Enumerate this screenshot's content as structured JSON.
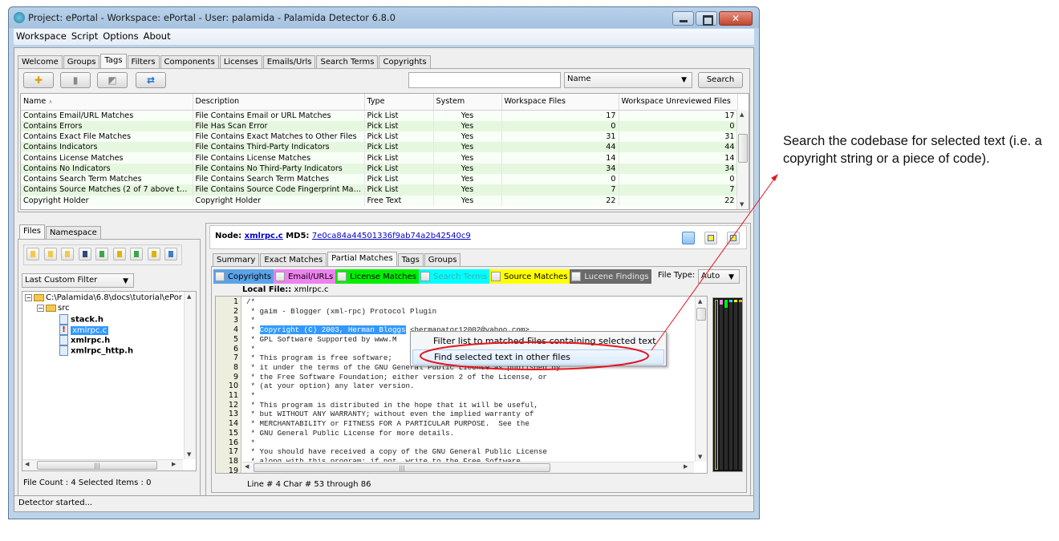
{
  "window": {
    "title": "Project: ePortal - Workspace: ePortal - User: palamida - Palamida Detector 6.8.0",
    "close_glyph": "✕"
  },
  "menu": [
    "Workspace",
    "Script",
    "Options",
    "About"
  ],
  "top_tabs": [
    {
      "label": "Welcome",
      "active": false
    },
    {
      "label": "Groups",
      "active": false
    },
    {
      "label": "Tags",
      "active": true
    },
    {
      "label": "Filters",
      "active": false
    },
    {
      "label": "Components",
      "active": false
    },
    {
      "label": "Licenses",
      "active": false
    },
    {
      "label": "Emails/Urls",
      "active": false
    },
    {
      "label": "Search Terms",
      "active": false
    },
    {
      "label": "Copyrights",
      "active": false
    }
  ],
  "toolbar": {
    "buttons": [
      {
        "icon": "add-tag-icon",
        "glyph": "✚"
      },
      {
        "icon": "delete-tag-icon",
        "glyph": "▮"
      },
      {
        "icon": "edit-tag-icon",
        "glyph": "◩"
      },
      {
        "icon": "refresh-icon",
        "glyph": "⇄"
      }
    ],
    "search_value": "",
    "search_field_selected": "Name",
    "search_label": "Search"
  },
  "tags_table": {
    "columns": [
      "Name",
      "Description",
      "Type",
      "System",
      "Workspace Files",
      "Workspace Unreviewed Files"
    ],
    "sort_indicator": "∧",
    "rows": [
      [
        "Contains Email/URL Matches",
        "File Contains Email or URL Matches",
        "Pick List",
        "Yes",
        "17",
        "17"
      ],
      [
        "Contains Errors",
        "File Has Scan Error",
        "Pick List",
        "Yes",
        "0",
        "0"
      ],
      [
        "Contains Exact File Matches",
        "File Contains Exact Matches to Other Files",
        "Pick List",
        "Yes",
        "31",
        "31"
      ],
      [
        "Contains Indicators",
        "File Contains Third-Party Indicators",
        "Pick List",
        "Yes",
        "44",
        "44"
      ],
      [
        "Contains License Matches",
        "File Contains License Matches",
        "Pick List",
        "Yes",
        "14",
        "14"
      ],
      [
        "Contains No Indicators",
        "File Contains No Third-Party Indicators",
        "Pick List",
        "Yes",
        "34",
        "34"
      ],
      [
        "Contains Search Term Matches",
        "File Contains Search Term Matches",
        "Pick List",
        "Yes",
        "0",
        "0"
      ],
      [
        "Contains Source Matches (2 of 7 above th...",
        "File Contains Source Code Fingerprint Mat...",
        "Pick List",
        "Yes",
        "7",
        "7"
      ],
      [
        "Copyright Holder",
        "Copyright Holder",
        "Free Text",
        "Yes",
        "22",
        "22"
      ]
    ]
  },
  "left_panel": {
    "tabs": [
      {
        "label": "Files",
        "active": true
      },
      {
        "label": "Namespace",
        "active": false
      }
    ],
    "tool_icons": [
      "expand-all-icon",
      "collapse-all-icon",
      "tree-view-icon",
      "flat-view-icon",
      "mark-reviewed-icon",
      "warning-file-icon",
      "approve-icon",
      "warning-icon",
      "find-file-icon"
    ],
    "filter_selected": "Last Custom Filter",
    "tree": {
      "root": "C:\\Palamida\\6.8\\docs\\tutorial\\ePor",
      "folder": "src",
      "files": [
        {
          "name": "stack.h",
          "selected": false,
          "flag": false
        },
        {
          "name": "xmlrpc.c",
          "selected": true,
          "flag": true
        },
        {
          "name": "xmlrpc.h",
          "selected": false,
          "flag": false
        },
        {
          "name": "xmlrpc_http.h",
          "selected": false,
          "flag": false
        }
      ]
    },
    "footer": "File Count : 4   Selected Items : 0"
  },
  "right_panel": {
    "node_label": "Node:",
    "node_value": "xmlrpc.c",
    "md5_label": "MD5:",
    "md5_value": "7e0ca84a44501336f9ab74a2b42540c9",
    "view_icons": [
      "layout-single-icon",
      "layout-split-icon",
      "layout-compare-icon"
    ],
    "tabs": [
      {
        "label": "Summary",
        "active": false
      },
      {
        "label": "Exact Matches",
        "active": false
      },
      {
        "label": "Partial Matches",
        "active": true
      },
      {
        "label": "Tags",
        "active": false
      },
      {
        "label": "Groups",
        "active": false
      }
    ],
    "legend": [
      {
        "label": "Copyrights",
        "color": "#5ba3e8",
        "text": "#000000"
      },
      {
        "label": "Email/URLs",
        "color": "#ee82ee",
        "text": "#000000"
      },
      {
        "label": "License Matches",
        "color": "#00ee00",
        "text": "#000000"
      },
      {
        "label": "Search Terms",
        "color": "#00ffff",
        "text": "#44aaaa"
      },
      {
        "label": "Source Matches",
        "color": "#ffff00",
        "text": "#000000"
      },
      {
        "label": "Lucene Findings",
        "color": "#6a6a6a",
        "text": "#e8e8e8"
      }
    ],
    "file_type_label": "File Type:",
    "file_type_value": "Auto",
    "local_file_label": "Local File::",
    "local_file_value": "xmlrpc.c",
    "code_lines": [
      {
        "n": "1",
        "text": "/*"
      },
      {
        "n": "2",
        "text": " * gaim - Blogger (xml-rpc) Protocol Plugin"
      },
      {
        "n": "3",
        "text": " *"
      },
      {
        "n": "4",
        "pre": " * ",
        "sel": "Copyright (C) 2003, Herman Bloggs",
        "post": " <hermanator12002@yahoo.com>"
      },
      {
        "n": "5",
        "text": " * GPL Software Supported by www.M"
      },
      {
        "n": "6",
        "text": " *"
      },
      {
        "n": "7",
        "text": " * This program is free software;"
      },
      {
        "n": "8",
        "text": " * it under the terms of the GNU General Public License as published by"
      },
      {
        "n": "9",
        "text": " * the Free Software Foundation; either version 2 of the License, or"
      },
      {
        "n": "10",
        "text": " * (at your option) any later version."
      },
      {
        "n": "11",
        "text": " *"
      },
      {
        "n": "12",
        "text": " * This program is distributed in the hope that it will be useful,"
      },
      {
        "n": "13",
        "text": " * but WITHOUT ANY WARRANTY; without even the implied warranty of"
      },
      {
        "n": "14",
        "text": " * MERCHANTABILITY or FITNESS FOR A PARTICULAR PURPOSE.  See the"
      },
      {
        "n": "15",
        "text": " * GNU General Public License for more details."
      },
      {
        "n": "16",
        "text": " *"
      },
      {
        "n": "17",
        "text": " * You should have received a copy of the GNU General Public License"
      },
      {
        "n": "18",
        "text": " * along with this program; if not, write to the Free Software"
      },
      {
        "n": "19",
        "text": ""
      }
    ],
    "position_text": "Line # 4  Char # 53 through 86",
    "context_menu": [
      {
        "label": "Filter list to matched Files containing selected text",
        "hover": false
      },
      {
        "label": "Find selected text in other files",
        "hover": true
      }
    ]
  },
  "status_bar": "Detector started...",
  "annotation": {
    "text": "Search the codebase for selected text (i.e. a copyright string or a piece of code).",
    "color": "#e8141c"
  }
}
